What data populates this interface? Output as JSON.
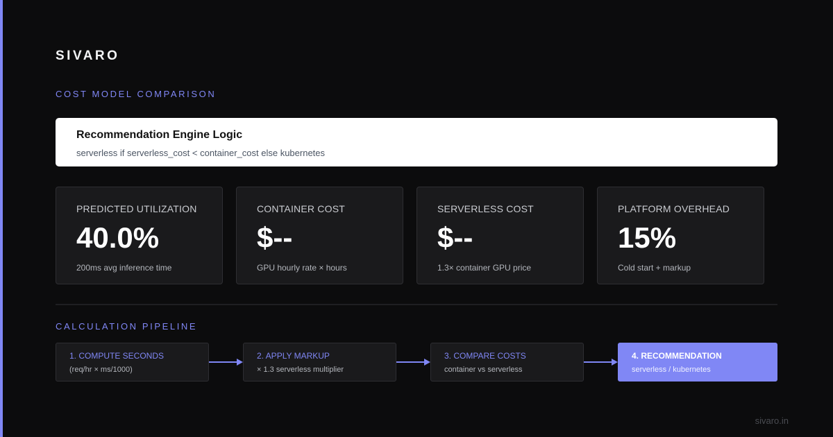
{
  "brand": "SIVARO",
  "sections": {
    "cost_model": "COST MODEL COMPARISON",
    "pipeline": "CALCULATION PIPELINE"
  },
  "logic_card": {
    "title": "Recommendation Engine Logic",
    "expression": "serverless if serverless_cost < container_cost else kubernetes"
  },
  "metrics": [
    {
      "label": "PREDICTED UTILIZATION",
      "value": "40.0%",
      "note": "200ms avg inference time"
    },
    {
      "label": "CONTAINER COST",
      "value": "$--",
      "note": "GPU hourly rate × hours"
    },
    {
      "label": "SERVERLESS COST",
      "value": "$--",
      "note": "1.3× container GPU price"
    },
    {
      "label": "PLATFORM OVERHEAD",
      "value": "15%",
      "note": "Cold start + markup"
    }
  ],
  "pipeline_steps": [
    {
      "title": "1. COMPUTE SECONDS",
      "sub": "(req/hr × ms/1000)"
    },
    {
      "title": "2. APPLY MARKUP",
      "sub": "× 1.3 serverless multiplier"
    },
    {
      "title": "3. COMPARE COSTS",
      "sub": "container vs serverless"
    },
    {
      "title": "4. RECOMMENDATION",
      "sub": "serverless / kubernetes"
    }
  ],
  "footer": "sivaro.in",
  "colors": {
    "accent": "#8087f5",
    "background": "#0c0c0d",
    "card": "#1a1a1c",
    "card_border": "#2e2e32"
  },
  "icons": [
    "arrow-right-icon",
    "arrow-right-icon",
    "arrow-right-icon"
  ]
}
